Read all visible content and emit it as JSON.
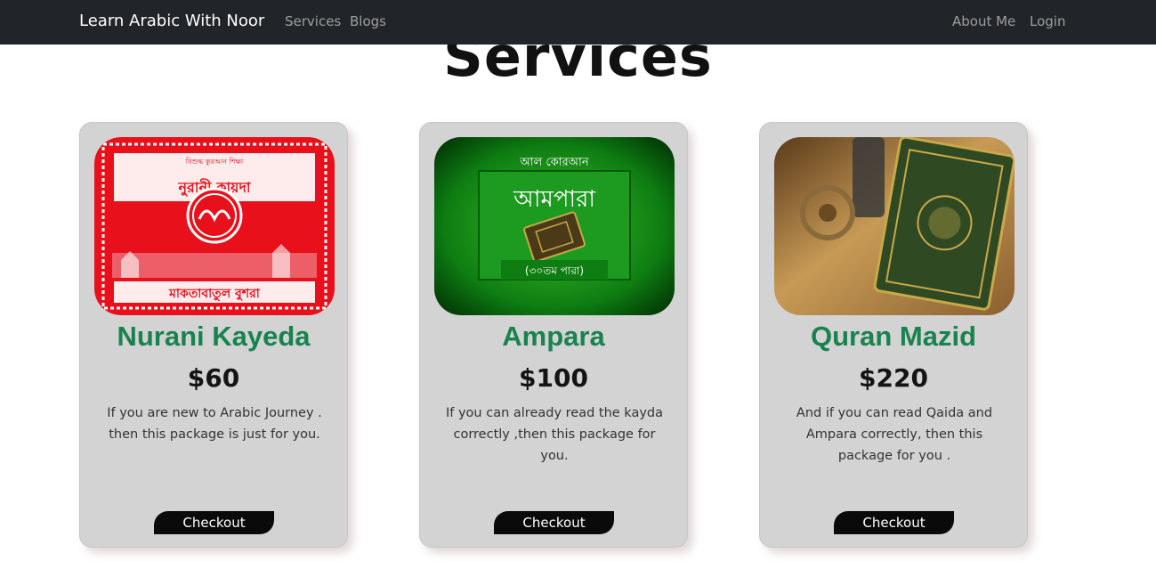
{
  "navbar": {
    "brand": "Learn Arabic With Noor",
    "left_links": [
      "Services",
      "Blogs"
    ],
    "right_links": [
      "About Me",
      "Login"
    ]
  },
  "page": {
    "title": "Services"
  },
  "cards": [
    {
      "title": "Nurani Kayeda",
      "price": "$60",
      "description": "If you are new to Arabic Journey . then this package is just for you.",
      "button": "Checkout",
      "image": {
        "header_text": "নুরানী কায়দা",
        "footer_text": "মাকতাবাতুল বুশরা",
        "accent": "#e8101b"
      }
    },
    {
      "title": "Ampara",
      "price": "$100",
      "description": "If you can already read the kayda correctly ,then this package for you.",
      "button": "Checkout",
      "image": {
        "top_text": "আল কোরআন",
        "main_text": "আমপারা",
        "sub_text": "(৩০তম পারা)",
        "accent": "#0e7d12"
      }
    },
    {
      "title": "Quran Mazid",
      "price": "$220",
      "description": "And if you can read Qaida and Ampara correctly, then this package for you .",
      "button": "Checkout",
      "image": {
        "accent": "#2f4a22"
      }
    }
  ],
  "colors": {
    "navbar_bg": "#212529",
    "card_bg": "#d3d3d3",
    "title_green": "#19834f",
    "button_bg": "#0a0a0a"
  }
}
